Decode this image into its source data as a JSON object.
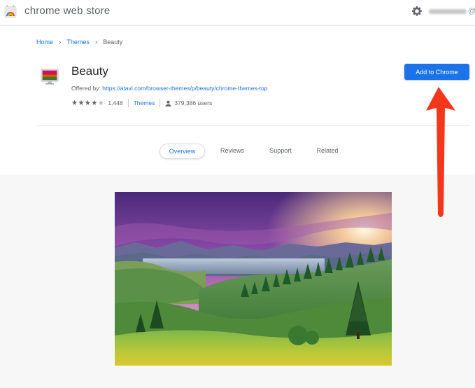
{
  "header": {
    "store_name": "chrome web store",
    "account_suffix": "@g"
  },
  "breadcrumb": {
    "home": "Home",
    "themes": "Themes",
    "current": "Beauty"
  },
  "item": {
    "title": "Beauty",
    "offered_by_label": "Offered by:",
    "offered_by_link": "https://atavi.com/browser-themes/p/beauty/chrome-themes-top",
    "rating": 4.5,
    "rating_stars": "★★★★",
    "rating_half": "★",
    "rating_count": "1,448",
    "category": "Themes",
    "users": "379,386 users",
    "add_button": "Add to Chrome"
  },
  "tabs": [
    {
      "label": "Overview",
      "active": true
    },
    {
      "label": "Reviews",
      "active": false
    },
    {
      "label": "Support",
      "active": false
    },
    {
      "label": "Related",
      "active": false
    }
  ],
  "colors": {
    "accent": "#1a73e8",
    "annotation_arrow": "#f4361a"
  },
  "icons": [
    "chrome-web-store-logo-icon",
    "gear-icon",
    "theme-icon",
    "star-icon",
    "user-icon",
    "red-arrow-icon"
  ]
}
